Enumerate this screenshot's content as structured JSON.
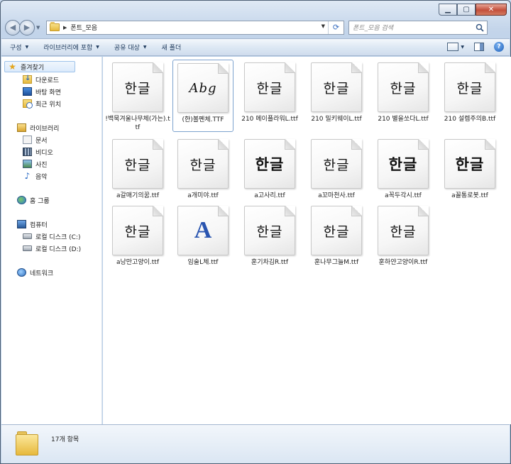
{
  "window": {
    "title": "폰트_모음"
  },
  "address": {
    "path": "폰트_모음"
  },
  "search": {
    "placeholder": "폰트_모음 검색"
  },
  "toolbar": {
    "organize": "구성",
    "include_library": "라이브러리에 포함",
    "share": "공유 대상",
    "new_folder": "새 폴더"
  },
  "nav": {
    "favorites": "즐겨찾기",
    "downloads": "다운로드",
    "desktop": "바탕 화면",
    "recent": "최근 위치",
    "libraries": "라이브러리",
    "documents": "문서",
    "videos": "비디오",
    "pictures": "사진",
    "music": "음악",
    "homegroup": "홈 그룹",
    "computer": "컴퓨터",
    "disk_c": "로컬 디스크 (C:)",
    "disk_d": "로컬 디스크 (D:)",
    "network": "네트워크"
  },
  "files": [
    {
      "name": "!백묵겨울나무체(가는).ttf",
      "preview": "한글"
    },
    {
      "name": "(한)볼펜체.TTF",
      "preview": "Abg"
    },
    {
      "name": "210 메이플라워L.ttf",
      "preview": "한글"
    },
    {
      "name": "210 밀키웨이L.ttf",
      "preview": "한글"
    },
    {
      "name": "210 별을쏘다L.ttf",
      "preview": "한글"
    },
    {
      "name": "210 설렘주의B.ttf",
      "preview": "한글"
    },
    {
      "name": "a갈매기의꿈.ttf",
      "preview": "한글"
    },
    {
      "name": "a개미야.ttf",
      "preview": "한글"
    },
    {
      "name": "a고사리.ttf",
      "preview": "한글"
    },
    {
      "name": "a꼬마천사.ttf",
      "preview": "한글"
    },
    {
      "name": "a꼭두각시.ttf",
      "preview": "한글"
    },
    {
      "name": "a꼴통로봇.ttf",
      "preview": "한글"
    },
    {
      "name": "a낭만고양이.ttf",
      "preview": "한글"
    },
    {
      "name": "임술L체.ttf",
      "preview": "A"
    },
    {
      "name": "훈기차김R.ttf",
      "preview": "한글"
    },
    {
      "name": "훈나무그늘M.ttf",
      "preview": "한글"
    },
    {
      "name": "훈하얀고양이R.ttf",
      "preview": "한글"
    }
  ],
  "status": {
    "count": "17개 항목"
  }
}
